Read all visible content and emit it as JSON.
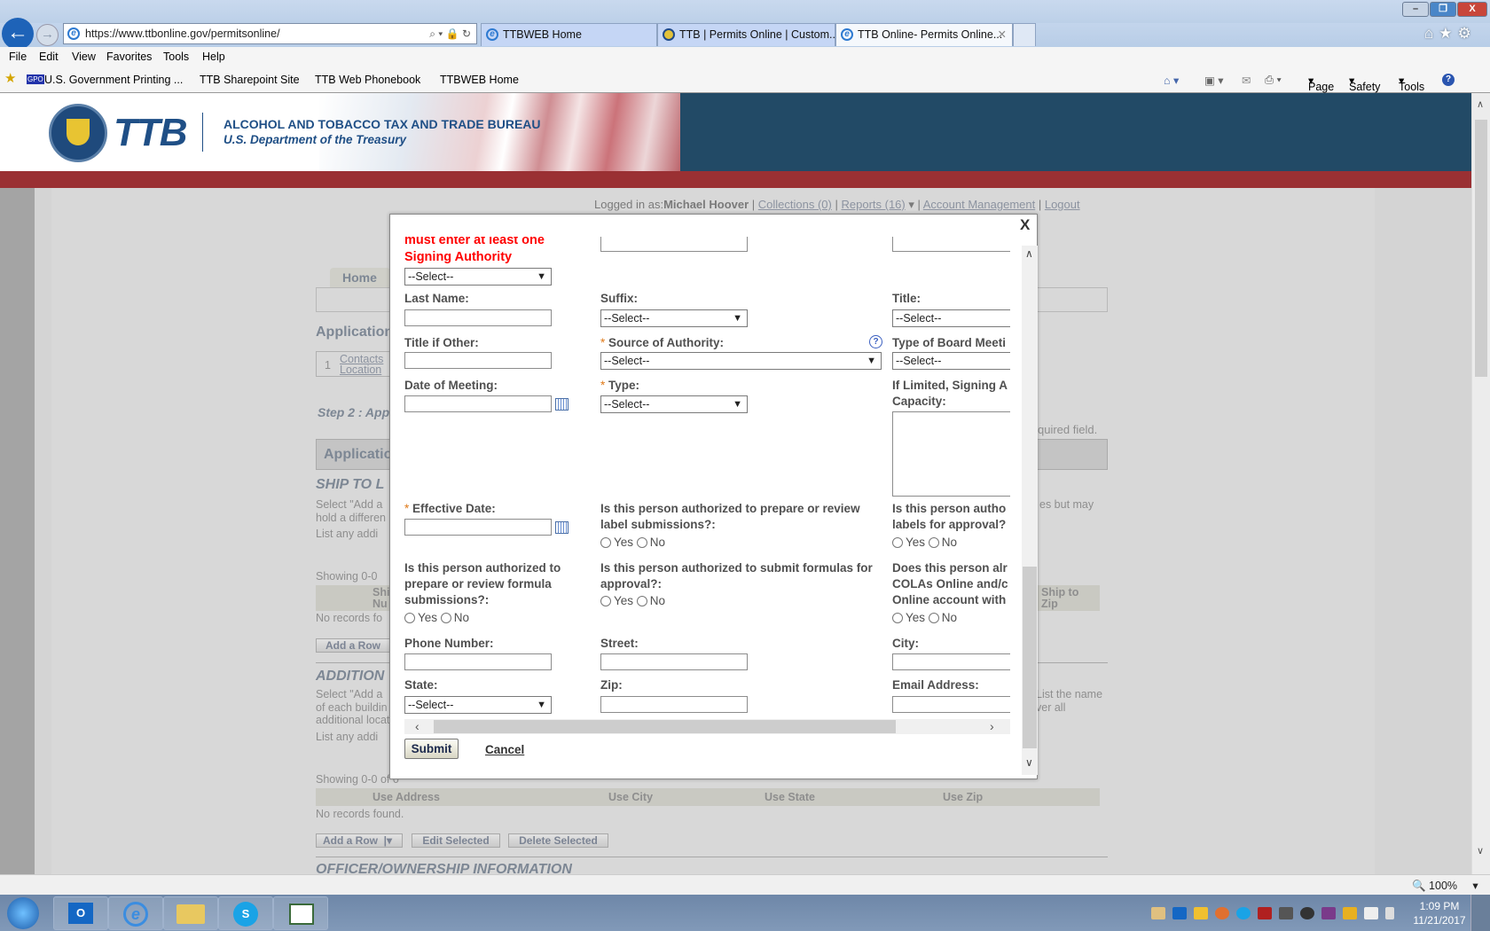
{
  "browser": {
    "url": "https://www.ttbonline.gov/permitsonline/",
    "tabs": [
      {
        "label": "TTBWEB Home",
        "active": false
      },
      {
        "label": "TTB | Permits Online | Custom...",
        "active": false
      },
      {
        "label": "TTB Online- Permits Online...",
        "active": true
      }
    ],
    "menu": [
      "File",
      "Edit",
      "View",
      "Favorites",
      "Tools",
      "Help"
    ],
    "favorites": [
      "U.S. Government Printing ...",
      "TTB Sharepoint Site",
      "TTB Web Phonebook",
      "TTBWEB Home"
    ],
    "command_bar": [
      "Page",
      "Safety",
      "Tools"
    ],
    "zoom": "100%"
  },
  "header": {
    "logo": "TTB",
    "agency": "ALCOHOL AND TOBACCO TAX AND TRADE BUREAU",
    "dept": "U.S. Department of the Treasury",
    "colors": {
      "band": "#9a3033",
      "blue": "#224a66"
    }
  },
  "topnav": {
    "logged_in_prefix": "Logged in as:",
    "user": "Michael Hoover",
    "links": [
      "Collections (0)",
      "Reports (16)",
      "Account Management",
      "Logout"
    ]
  },
  "background": {
    "home_tab": "Home",
    "application_heading": "Application",
    "step_num": "1",
    "step_links": [
      "Contacts",
      "Location"
    ],
    "step2": "Step 2 : App",
    "required_note": "quired field.",
    "app_bar": "Applicatio",
    "ship_heading": "SHIP TO L",
    "ship_text": [
      "Select \"Add a",
      "hold a differen",
      "List any addi"
    ],
    "ship_right": "es but may",
    "showing1": "Showing 0-0",
    "ship_cols": [
      "Shi",
      "Nu"
    ],
    "ship_right_col": [
      "Ship to",
      "Zip"
    ],
    "no_records1": "No records fo",
    "add_row1": "Add a Row",
    "additional_heading": "ADDITION",
    "add_text": [
      "Select \"Add a",
      "of each buildin",
      "additional locat",
      "List any addi"
    ],
    "add_right": [
      "List the name",
      "ver all"
    ],
    "showing2": "Showing 0-0 of 0",
    "use_cols": [
      "Use Address",
      "Use City",
      "Use State",
      "Use Zip"
    ],
    "no_records2": "No records found.",
    "buttons": [
      "Add a Row",
      "Edit Selected",
      "Delete Selected"
    ],
    "officer_heading": "OFFICER/OWNERSHIP INFORMATION"
  },
  "modal": {
    "close": "X",
    "error": [
      "must enter at least one",
      "Signing Authority"
    ],
    "select_placeholder": "--Select--",
    "labels": {
      "last_name": "Last Name:",
      "suffix": "Suffix:",
      "title": "Title:",
      "title_other": "Title if Other:",
      "source_authority": "Source of Authority:",
      "board_meeting": "Type of Board Meeti",
      "date_meeting": "Date of Meeting:",
      "type": "Type:",
      "if_limited": [
        "If Limited, Signing A",
        "Capacity:"
      ],
      "effective_date": "Effective Date:",
      "q_label": [
        "Is this person authorized to prepare or review",
        "label submissions?:"
      ],
      "q_labels_approval": [
        "Is this person autho",
        "labels for approval?"
      ],
      "q_formula": [
        "Is this person authorized to",
        "prepare or review formula",
        "submissions?:"
      ],
      "q_submit_formula": [
        "Is this person authorized to submit formulas for",
        "approval?:"
      ],
      "q_already": [
        "Does this person alr",
        "COLAs Online and/c",
        "Online account with"
      ],
      "phone": "Phone Number:",
      "street": "Street:",
      "city": "City:",
      "state": "State:",
      "zip": "Zip:",
      "email": "Email Address:"
    },
    "radio": {
      "yes": "Yes",
      "no": "No"
    },
    "submit": "Submit",
    "cancel": "Cancel"
  },
  "taskbar": {
    "time": "1:09 PM",
    "date": "11/21/2017"
  }
}
